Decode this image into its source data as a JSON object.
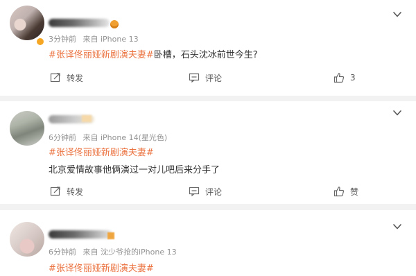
{
  "posts": [
    {
      "time": "3分钟前",
      "source": "来自 iPhone 13",
      "lines": [
        {
          "hashtag": "#张译佟丽娅新剧演夫妻#",
          "text": "卧槽，石头沈冰前世今生?"
        }
      ],
      "repost_label": "转发",
      "comment_label": "评论",
      "like_label": "3"
    },
    {
      "time": "6分钟前",
      "source": "来自 iPhone 14(星光色)",
      "lines": [
        {
          "hashtag": "#张译佟丽娅新剧演夫妻#",
          "text": ""
        },
        {
          "hashtag": "",
          "text": "北京爱情故事他俩演过一对儿吧后来分手了"
        }
      ],
      "repost_label": "转发",
      "comment_label": "评论",
      "like_label": "赞"
    },
    {
      "time": "6分钟前",
      "source": "来自 沈少爷抢的iPhone 13",
      "lines": [
        {
          "hashtag": "#张译佟丽娅新剧演夫妻#",
          "text": ""
        }
      ]
    }
  ],
  "colors": {
    "hashtag": "#eb7340",
    "meta": "#939393",
    "background": "#f2f2f2"
  },
  "icons": [
    "chevron-down-icon",
    "repost-icon",
    "comment-icon",
    "thumbs-up-icon"
  ]
}
